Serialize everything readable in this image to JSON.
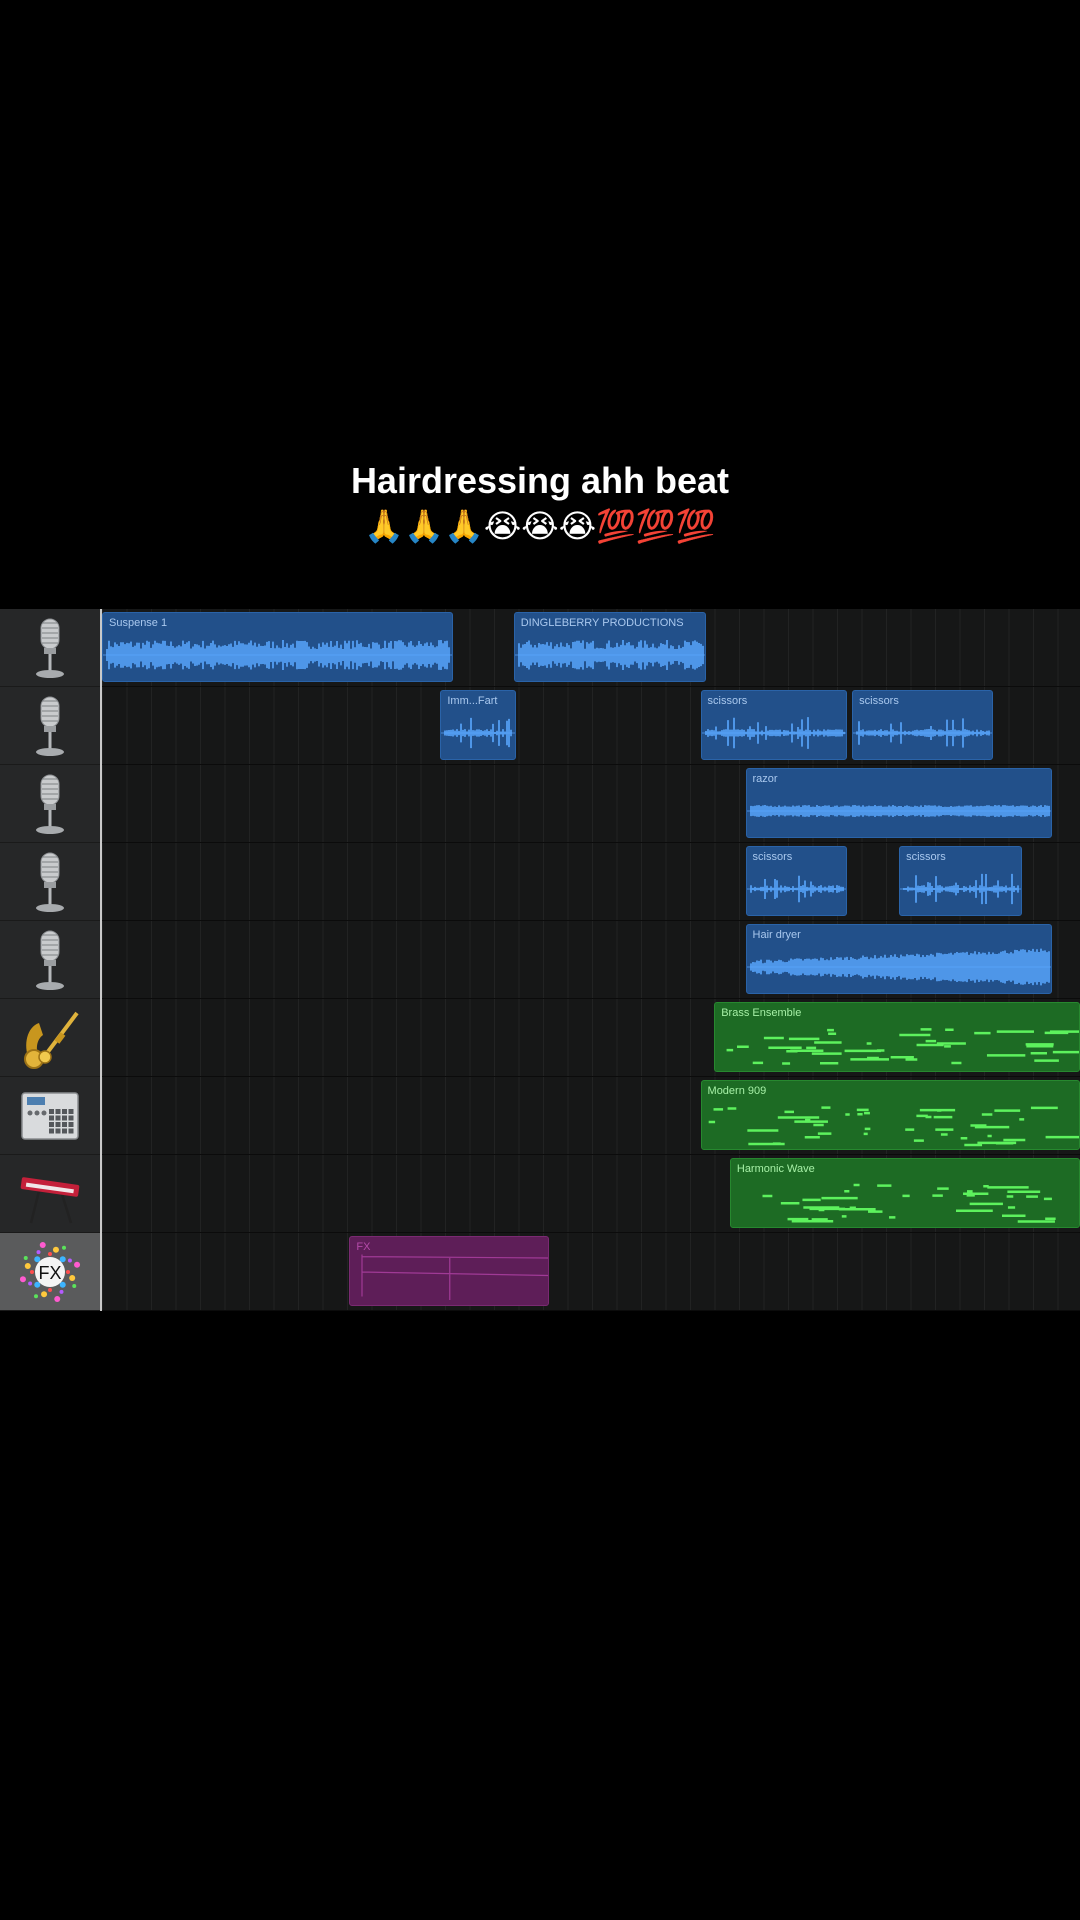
{
  "caption": {
    "title": "Hairdressing ahh beat",
    "emoji": "🙏🙏🙏😭😭😭💯💯💯"
  },
  "tracks": [
    {
      "icon": "microphone-icon",
      "regions": [
        {
          "type": "audio",
          "label": "Suspense 1",
          "start": 0,
          "end": 35.9
        },
        {
          "type": "audio",
          "label": "DINGLEBERRY PRODUCTIONS",
          "start": 42.1,
          "end": 61.8
        }
      ]
    },
    {
      "icon": "microphone-icon",
      "regions": [
        {
          "type": "audio",
          "label": "Imm...Fart",
          "start": 34.6,
          "end": 42.3
        },
        {
          "type": "audio",
          "label": "scissors",
          "start": 61.2,
          "end": 76.2
        },
        {
          "type": "audio",
          "label": "scissors",
          "start": 76.7,
          "end": 91.1
        }
      ]
    },
    {
      "icon": "microphone-icon",
      "regions": [
        {
          "type": "audio",
          "label": "razor",
          "start": 65.8,
          "end": 97.1
        }
      ]
    },
    {
      "icon": "microphone-icon",
      "regions": [
        {
          "type": "audio",
          "label": "scissors",
          "start": 65.8,
          "end": 76.2
        },
        {
          "type": "audio",
          "label": "scissors",
          "start": 81.5,
          "end": 94.1
        }
      ]
    },
    {
      "icon": "microphone-icon",
      "regions": [
        {
          "type": "audio",
          "label": "Hair dryer",
          "start": 65.8,
          "end": 97.1
        }
      ]
    },
    {
      "icon": "brass-instruments-icon",
      "regions": [
        {
          "type": "midi",
          "label": "Brass Ensemble",
          "start": 62.6,
          "end": 100
        }
      ]
    },
    {
      "icon": "drum-machine-icon",
      "regions": [
        {
          "type": "midi",
          "label": "Modern 909",
          "start": 61.2,
          "end": 100
        }
      ]
    },
    {
      "icon": "keyboard-synth-icon",
      "regions": [
        {
          "type": "midi",
          "label": "Harmonic Wave",
          "start": 64.2,
          "end": 100
        }
      ]
    },
    {
      "icon": "fx-icon",
      "icon_text": "FX",
      "selected": true,
      "regions": [
        {
          "type": "fx",
          "label": "FX",
          "start": 25.3,
          "end": 45.7
        }
      ]
    }
  ],
  "colors": {
    "audio_region": "#22508a",
    "audio_wave": "#5aa8ff",
    "midi_region": "#1d6b24",
    "midi_note": "#5df25d",
    "fx_region": "#5e1e58"
  }
}
